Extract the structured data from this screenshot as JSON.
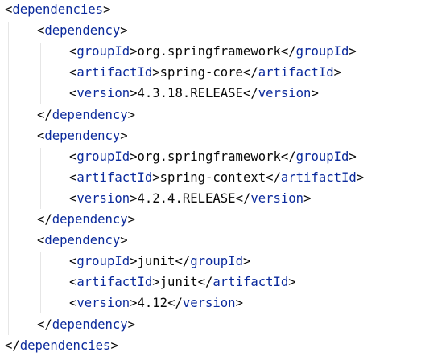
{
  "colors": {
    "tag": "#0b2a9c",
    "bracket": "#080808",
    "text": "#080808",
    "background": "#ffffff",
    "indent_guide": "#e6e6e6"
  },
  "lines": [
    {
      "depth": 0,
      "kind": "open",
      "tag": "dependencies"
    },
    {
      "depth": 1,
      "kind": "open",
      "tag": "dependency"
    },
    {
      "depth": 2,
      "kind": "element",
      "tag": "groupId",
      "value": "org.springframework"
    },
    {
      "depth": 2,
      "kind": "element",
      "tag": "artifactId",
      "value": "spring-core"
    },
    {
      "depth": 2,
      "kind": "element",
      "tag": "version",
      "value": "4.3.18.RELEASE"
    },
    {
      "depth": 1,
      "kind": "close",
      "tag": "dependency"
    },
    {
      "depth": 1,
      "kind": "open",
      "tag": "dependency"
    },
    {
      "depth": 2,
      "kind": "element",
      "tag": "groupId",
      "value": "org.springframework"
    },
    {
      "depth": 2,
      "kind": "element",
      "tag": "artifactId",
      "value": "spring-context"
    },
    {
      "depth": 2,
      "kind": "element",
      "tag": "version",
      "value": "4.2.4.RELEASE"
    },
    {
      "depth": 1,
      "kind": "close",
      "tag": "dependency"
    },
    {
      "depth": 1,
      "kind": "open",
      "tag": "dependency"
    },
    {
      "depth": 2,
      "kind": "element",
      "tag": "groupId",
      "value": "junit"
    },
    {
      "depth": 2,
      "kind": "element",
      "tag": "artifactId",
      "value": "junit"
    },
    {
      "depth": 2,
      "kind": "element",
      "tag": "version",
      "value": "4.12"
    },
    {
      "depth": 1,
      "kind": "close",
      "tag": "dependency"
    },
    {
      "depth": 0,
      "kind": "close",
      "tag": "dependencies"
    }
  ]
}
